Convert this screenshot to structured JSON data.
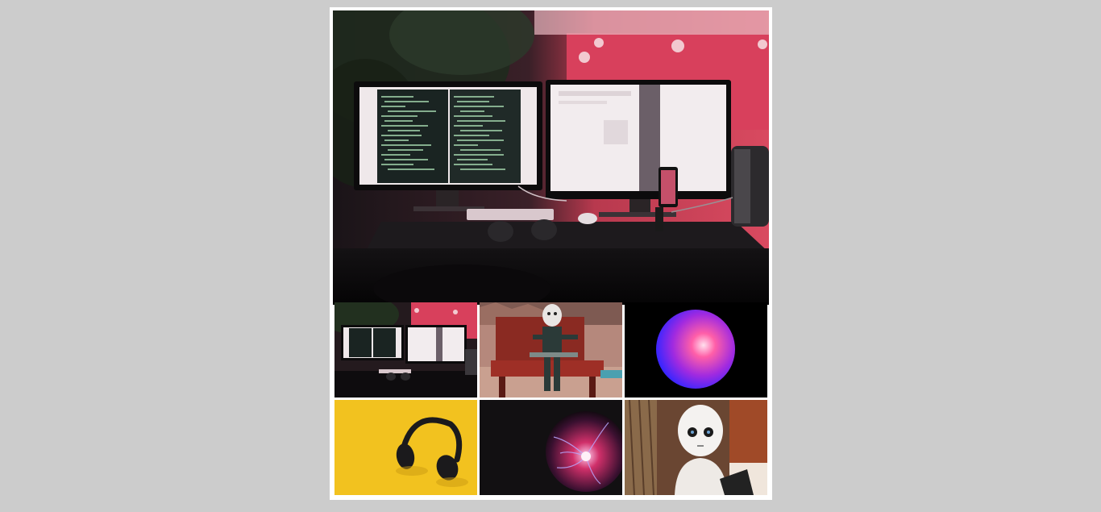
{
  "gallery": {
    "selected_index": 0,
    "main_image": {
      "description_icon": "desk-setup-image"
    },
    "thumbnails": [
      {
        "icon": "desk-setup-thumbnail"
      },
      {
        "icon": "robot-on-bench-thumbnail"
      },
      {
        "icon": "glowing-sphere-thumbnail"
      },
      {
        "icon": "headphones-thumbnail"
      },
      {
        "icon": "plasma-ball-thumbnail"
      },
      {
        "icon": "pepper-robot-thumbnail"
      }
    ]
  },
  "colors": {
    "page_background": "#cccccc",
    "frame_background": "#ffffff",
    "accent_red": "#e0405a",
    "headphones_yellow": "#f2c21f"
  }
}
